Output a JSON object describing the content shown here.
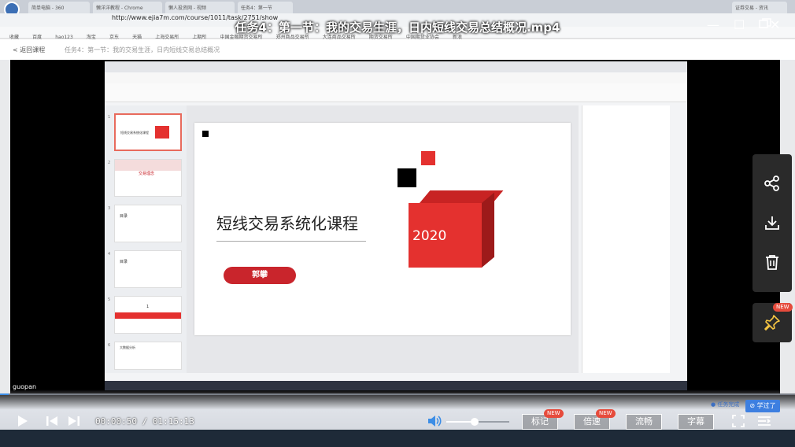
{
  "window": {
    "title": "任务4：第一节：我的交易生涯，日内短线交易总结概况.mp4",
    "minimize_glyph": "—",
    "maximize_glyph": "☐",
    "close_glyph": "✕"
  },
  "captured_browser": {
    "url": "http://www.ejia7m.com/course/1011/task/2751/show",
    "tabs": [
      "简单电脑 - 360",
      "懒洋洋教程 - Chrome",
      "懒人投资网 - 视频",
      "任务4：第一节",
      "证券交易 - 资讯"
    ],
    "bookmarks": [
      "收藏",
      "百度",
      "hao123",
      "淘宝",
      "京东",
      "天猫",
      "上海交易所",
      "上期所",
      "中国金融期货交易所",
      "郑州商品交易所",
      "大连商品交易所",
      "期货交易所",
      "中国期货业协会",
      "新浪",
      "WWW."
    ],
    "back_label": "< 返回课程",
    "breadcrumb": "任务4：第一节：我的交易生涯，日内短线交易总结概况"
  },
  "slide": {
    "title": "短线交易系统化课程",
    "author": "郭攀",
    "year": "2020"
  },
  "thumbnails": [
    {
      "num": "1",
      "label": "短线交易系统化课程"
    },
    {
      "num": "2",
      "label": "交易理念"
    },
    {
      "num": "3",
      "label": "目录"
    },
    {
      "num": "4",
      "label": "目录"
    },
    {
      "num": "5",
      "label": "1"
    },
    {
      "num": "6",
      "label": "大数据分析"
    }
  ],
  "watermark": "guopan",
  "player": {
    "current_time": "00:00:50",
    "duration": "01:15:13",
    "time_sep": " / ",
    "progress_percent": 1.1,
    "volume_percent": 45,
    "buttons": {
      "mark": "标记",
      "speed": "倍速",
      "quality": "流畅",
      "subtitle": "字幕"
    },
    "new_badge": "NEW",
    "done_label": "任务完成",
    "learned_label": "学过了"
  },
  "side_panel": {
    "new_badge": "NEW"
  },
  "colors": {
    "accent": "#3d8ee6",
    "badge": "#e64b3c",
    "slide_red": "#e4312f"
  }
}
